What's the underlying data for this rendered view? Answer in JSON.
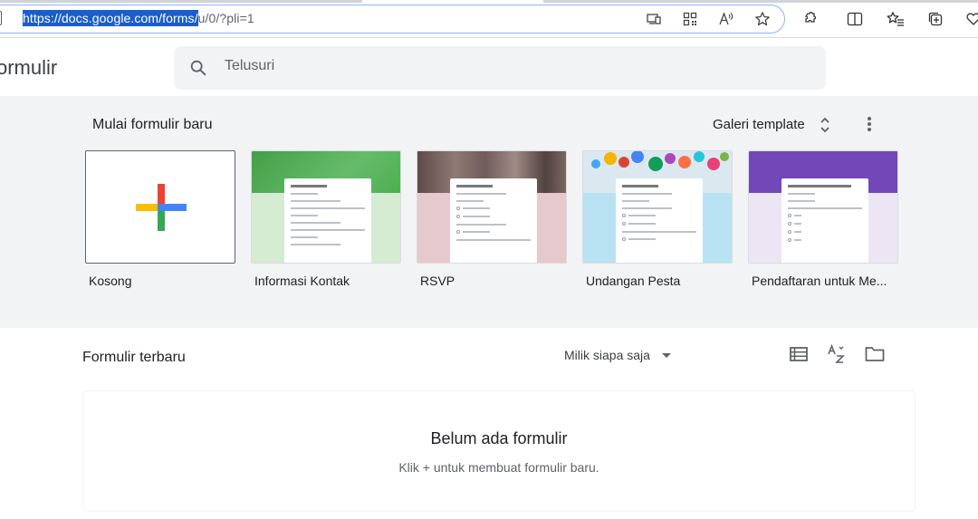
{
  "browser": {
    "url_selected": "https://docs.google.com/forms/",
    "url_rest": "u/0/?pli=1"
  },
  "app": {
    "title": "ormulir",
    "search_placeholder": "Telusuri"
  },
  "gallery": {
    "title": "Mulai formulir baru",
    "gallery_link": "Galeri template",
    "templates": [
      {
        "label": "Kosong"
      },
      {
        "label": "Informasi Kontak",
        "accent": "#43a047",
        "bg": "#d5ebd2"
      },
      {
        "label": "RSVP",
        "accent": "#6d5a55",
        "bg": "#e6c9cc"
      },
      {
        "label": "Undangan Pesta",
        "accent": "#d7e7f1",
        "bg": "#b9e3f2"
      },
      {
        "label": "Pendaftaran untuk Me...",
        "accent": "#7248b9",
        "bg": "#ece5f4"
      }
    ]
  },
  "recent": {
    "title": "Formulir terbaru",
    "owner_filter": "Milik siapa saja",
    "empty_title": "Belum ada formulir",
    "empty_subtitle": "Klik + untuk membuat formulir baru."
  },
  "colors": {
    "google_blue": "#4285f4",
    "google_red": "#ea4335",
    "google_yellow": "#fbbc04",
    "google_green": "#34a853",
    "gallery_bg": "#f1f3f4"
  }
}
